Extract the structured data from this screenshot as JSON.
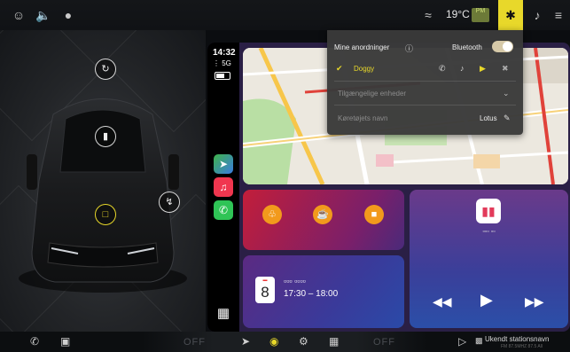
{
  "status_bar": {
    "temperature": "19°C",
    "air_quality": "PM",
    "icons": [
      "user-icon",
      "volume-icon",
      "media-icon",
      "wifi-icon",
      "bluetooth-icon",
      "bell-icon",
      "settings-sliders-icon"
    ]
  },
  "carplay": {
    "time": "14:32",
    "signal": "5G",
    "calendar": {
      "day": "8",
      "time_range": "17:30 – 18:00"
    }
  },
  "bluetooth_popup": {
    "title": "Mine anordninger",
    "bluetooth_label": "Bluetooth",
    "bluetooth_on": true,
    "device_name": "Doggy",
    "available_label": "Tilgængelige enheder",
    "vehicle_name_label": "Køretøjets navn",
    "vehicle_name": "Lotus"
  },
  "bottom_bar": {
    "left_off": "OFF",
    "right_off": "OFF",
    "station_name": "Ukendt stationsnavn",
    "station_sub": "FM 87.5MHZ 87.5  All"
  },
  "colors": {
    "accent_yellow": "#e8d82a",
    "device_connected": "#e8d82a"
  }
}
